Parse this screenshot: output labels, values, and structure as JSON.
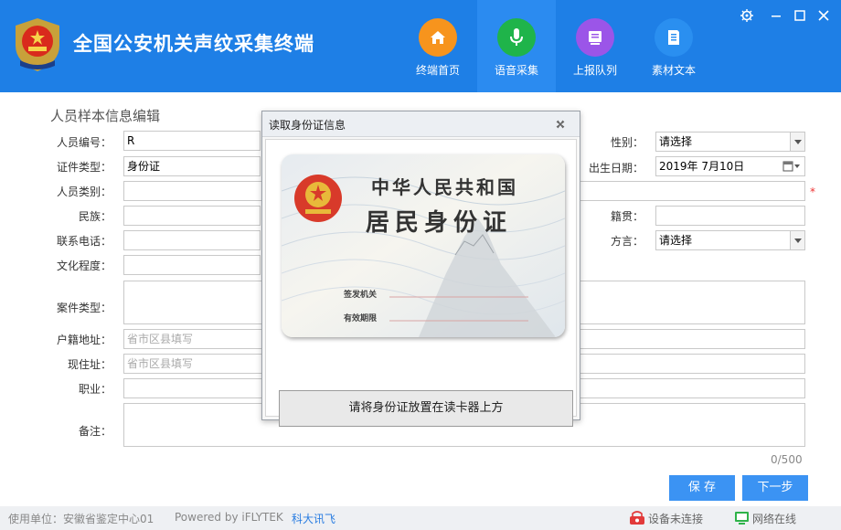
{
  "header": {
    "app_title": "全国公安机关声纹采集终端",
    "nav": [
      {
        "label": "终端首页",
        "icon": "home-icon",
        "color": "#f7941d"
      },
      {
        "label": "语音采集",
        "icon": "microphone-icon",
        "color": "#1fb44a"
      },
      {
        "label": "上报队列",
        "icon": "upload-queue-icon",
        "color": "#9b55e8"
      },
      {
        "label": "素材文本",
        "icon": "document-icon",
        "color": "#2a8ff0"
      }
    ],
    "active_nav": "语音采集"
  },
  "form": {
    "title": "人员样本信息编辑",
    "person_id": {
      "label": "人员编号：",
      "value": "R"
    },
    "id_type": {
      "label": "证件类型：",
      "value": "身份证"
    },
    "person_category": {
      "label": "人员类别：",
      "value": ""
    },
    "ethnicity": {
      "label": "民族：",
      "value": ""
    },
    "phone": {
      "label": "联系电话：",
      "value": ""
    },
    "education": {
      "label": "文化程度：",
      "value": ""
    },
    "case_type": {
      "label": "案件类型：",
      "value": ""
    },
    "household_address": {
      "label": "户籍地址：",
      "placeholder": "省市区县填写"
    },
    "current_address": {
      "label": "现住址：",
      "placeholder": "省市区县填写"
    },
    "occupation": {
      "label": "职业：",
      "value": ""
    },
    "remarks": {
      "label": "备注：",
      "value": ""
    },
    "gender": {
      "label": "性别：",
      "value": "请选择"
    },
    "birth_date": {
      "label": "出生日期：",
      "value": "2019年  7月10日"
    },
    "native_place": {
      "label": "籍贯：",
      "value": ""
    },
    "dialect": {
      "label": "方言：",
      "value": "请选择"
    },
    "required_mark": "*",
    "remarks_counter": "0/500",
    "save_label": "保  存",
    "next_label": "下一步"
  },
  "modal": {
    "title": "读取身份证信息",
    "card": {
      "line1": "中华人民共和国",
      "line2": "居民身份证",
      "field1": "签发机关",
      "field2": "有效期限"
    },
    "button_label": "请将身份证放置在读卡器上方"
  },
  "status_bar": {
    "unit": "使用单位：安徽省鉴定中心01",
    "powered": "Powered by iFLYTEK",
    "brand": "科大讯飞",
    "device_status": "设备未连接",
    "network_status": "网络在线",
    "device_color": "#e23a3a",
    "network_color": "#2fb34a"
  }
}
